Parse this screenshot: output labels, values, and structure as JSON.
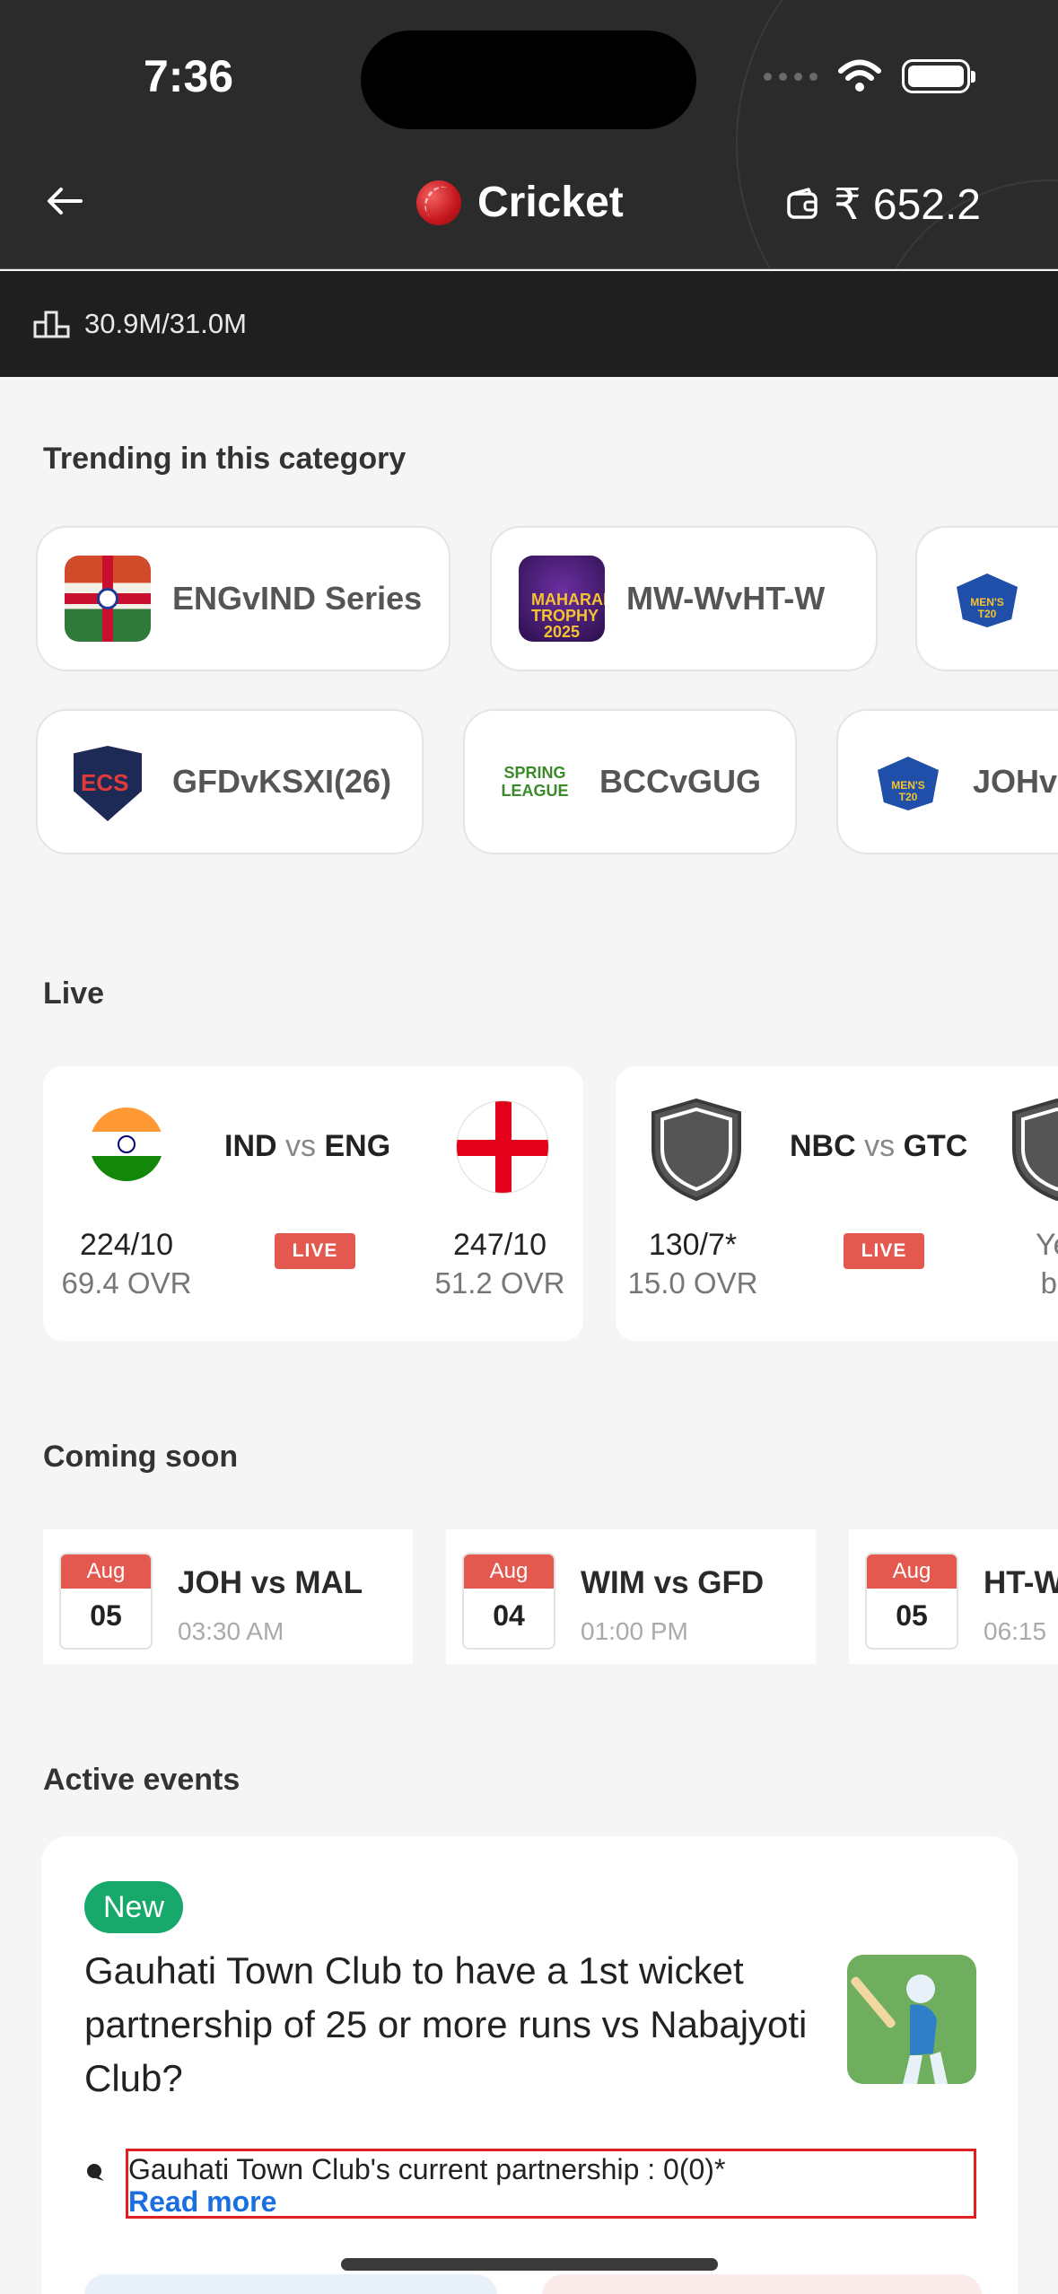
{
  "status_bar": {
    "time": "7:36"
  },
  "header": {
    "title": "Cricket",
    "wallet_balance": "₹ 652.2",
    "volume": "30.9M/31.0M"
  },
  "trending": {
    "title": "Trending in this category",
    "row1": [
      {
        "label": "ENGvIND Series",
        "thumb": "eng-ind-flag-icon"
      },
      {
        "label": "MW-WvHT-W",
        "thumb": "maharani-trophy-logo"
      },
      {
        "label": "",
        "thumb": "mca-mens-t20-logo"
      }
    ],
    "row2": [
      {
        "label": "GFDvKSXI(26)",
        "thumb": "ecs-england-logo"
      },
      {
        "label": "BCCvGUG",
        "thumb": "guwahati-spring-league-logo"
      },
      {
        "label": "JOHv",
        "thumb": "mca-mens-t20-logo"
      }
    ]
  },
  "live": {
    "title": "Live",
    "badge": "LIVE",
    "vs": "vs",
    "matches": [
      {
        "team1": "IND",
        "team2": "ENG",
        "score1": "224/10",
        "ovr1": "69.4 OVR",
        "score2": "247/10",
        "ovr2": "51.2 OVR"
      },
      {
        "team1": "NBC",
        "team2": "GTC",
        "score1": "130/7*",
        "ovr1": "15.0 OVR",
        "score2": "Yet",
        "ovr2": "ba"
      }
    ]
  },
  "coming_soon": {
    "title": "Coming soon",
    "matches": [
      {
        "month": "Aug",
        "day": "05",
        "match": "JOH vs MAL",
        "time": "03:30 AM"
      },
      {
        "month": "Aug",
        "day": "04",
        "match": "WIM vs GFD",
        "time": "01:00 PM"
      },
      {
        "month": "Aug",
        "day": "05",
        "match": "HT-W",
        "time": "06:15"
      }
    ]
  },
  "active_events": {
    "title": "Active events",
    "badge": "New",
    "question": "Gauhati Town Club to have a 1st wicket partnership of 25 or more runs vs Nabajyoti Club?",
    "info": "Gauhati Town Club's current partnership : 0(0)*",
    "read_more": "Read more"
  },
  "colors": {
    "header_bg": "#2b2b2b",
    "live_red": "#e35950",
    "new_green": "#16a96b",
    "link_blue": "#1a6fe0"
  }
}
